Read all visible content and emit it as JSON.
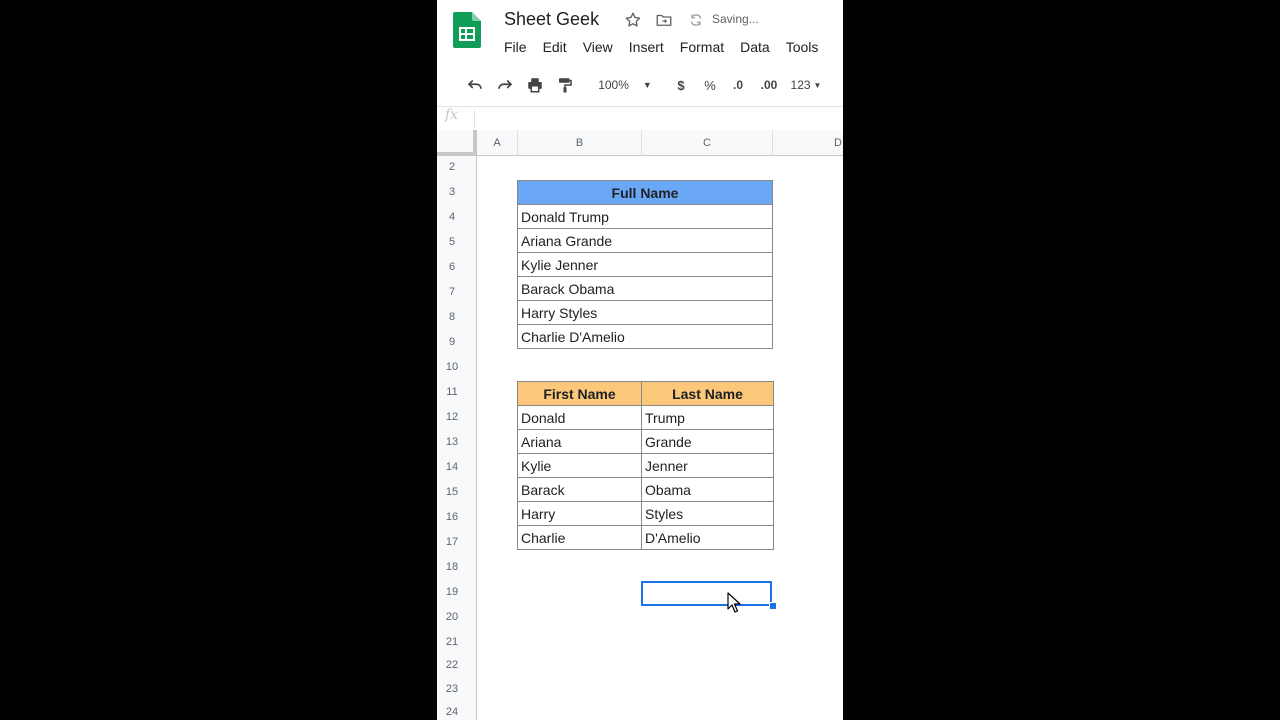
{
  "header": {
    "doc_title": "Sheet Geek",
    "saving_status": "Saving...",
    "menu": [
      "File",
      "Edit",
      "View",
      "Insert",
      "Format",
      "Data",
      "Tools"
    ]
  },
  "toolbar": {
    "zoom": "100%",
    "currency": "$",
    "percent": "%",
    "decrease_decimal": ".0",
    "increase_decimal": ".00",
    "more_formats": "123"
  },
  "formula_bar": {
    "fx": "fx"
  },
  "columns": [
    "A",
    "B",
    "C",
    "D"
  ],
  "rows": [
    "2",
    "3",
    "4",
    "5",
    "6",
    "7",
    "8",
    "9",
    "10",
    "11",
    "12",
    "13",
    "14",
    "15",
    "16",
    "17",
    "18",
    "19",
    "20",
    "21",
    "22",
    "23",
    "24"
  ],
  "full_name_table": {
    "header": "Full Name",
    "rows": [
      "Donald Trump",
      "Ariana Grande",
      "Kylie Jenner",
      "Barack Obama",
      "Harry Styles",
      "Charlie D'Amelio"
    ]
  },
  "split_table": {
    "headers": [
      "First Name",
      "Last Name"
    ],
    "rows": [
      [
        "Donald",
        "Trump"
      ],
      [
        "Ariana",
        "Grande"
      ],
      [
        "Kylie",
        "Jenner"
      ],
      [
        "Barack",
        "Obama"
      ],
      [
        "Harry",
        "Styles"
      ],
      [
        "Charlie",
        "D'Amelio"
      ]
    ]
  },
  "colors": {
    "full_name_header": "#6aa8f5",
    "split_header": "#fbc778",
    "selection": "#1a73e8",
    "sheets_green": "#0f9d58"
  },
  "icons": [
    "google-sheets-logo-icon",
    "star-icon",
    "move-to-folder-icon",
    "sync-icon",
    "undo-icon",
    "redo-icon",
    "print-icon",
    "paint-format-icon",
    "dropdown-arrow-icon",
    "mouse-cursor-icon"
  ]
}
